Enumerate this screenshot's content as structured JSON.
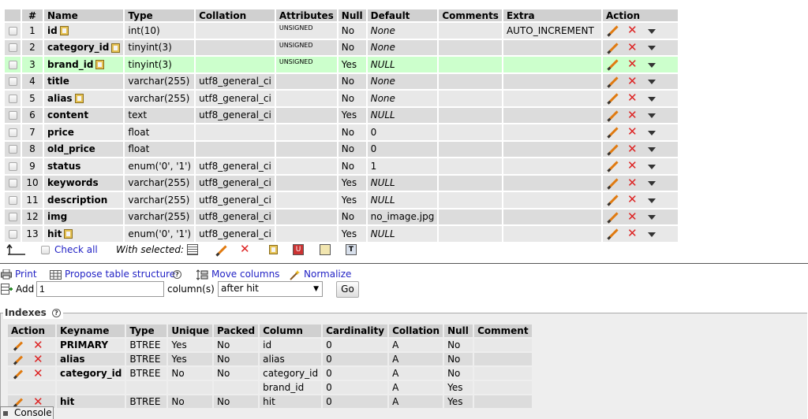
{
  "structure": {
    "columns": [
      "",
      "#",
      "Name",
      "Type",
      "Collation",
      "Attributes",
      "Null",
      "Default",
      "Comments",
      "Extra",
      "Action"
    ],
    "rows": [
      {
        "num": "1",
        "name": "id",
        "key": true,
        "type": "int(10)",
        "collation": "",
        "attributes": "UNSIGNED",
        "null": "No",
        "default": "None",
        "default_italic": true,
        "comments": "",
        "extra": "AUTO_INCREMENT"
      },
      {
        "num": "2",
        "name": "category_id",
        "key": true,
        "type": "tinyint(3)",
        "collation": "",
        "attributes": "UNSIGNED",
        "null": "No",
        "default": "None",
        "default_italic": true,
        "comments": "",
        "extra": ""
      },
      {
        "num": "3",
        "name": "brand_id",
        "key": true,
        "type": "tinyint(3)",
        "collation": "",
        "attributes": "UNSIGNED",
        "null": "Yes",
        "default": "NULL",
        "default_italic": true,
        "comments": "",
        "extra": "",
        "highlight": true
      },
      {
        "num": "4",
        "name": "title",
        "key": false,
        "type": "varchar(255)",
        "collation": "utf8_general_ci",
        "attributes": "",
        "null": "No",
        "default": "None",
        "default_italic": true,
        "comments": "",
        "extra": ""
      },
      {
        "num": "5",
        "name": "alias",
        "key": true,
        "type": "varchar(255)",
        "collation": "utf8_general_ci",
        "attributes": "",
        "null": "No",
        "default": "None",
        "default_italic": true,
        "comments": "",
        "extra": ""
      },
      {
        "num": "6",
        "name": "content",
        "key": false,
        "type": "text",
        "collation": "utf8_general_ci",
        "attributes": "",
        "null": "Yes",
        "default": "NULL",
        "default_italic": true,
        "comments": "",
        "extra": ""
      },
      {
        "num": "7",
        "name": "price",
        "key": false,
        "type": "float",
        "collation": "",
        "attributes": "",
        "null": "No",
        "default": "0",
        "default_italic": false,
        "comments": "",
        "extra": ""
      },
      {
        "num": "8",
        "name": "old_price",
        "key": false,
        "type": "float",
        "collation": "",
        "attributes": "",
        "null": "No",
        "default": "0",
        "default_italic": false,
        "comments": "",
        "extra": ""
      },
      {
        "num": "9",
        "name": "status",
        "key": false,
        "type": "enum('0', '1')",
        "collation": "utf8_general_ci",
        "attributes": "",
        "null": "No",
        "default": "1",
        "default_italic": false,
        "comments": "",
        "extra": ""
      },
      {
        "num": "10",
        "name": "keywords",
        "key": false,
        "type": "varchar(255)",
        "collation": "utf8_general_ci",
        "attributes": "",
        "null": "Yes",
        "default": "NULL",
        "default_italic": true,
        "comments": "",
        "extra": ""
      },
      {
        "num": "11",
        "name": "description",
        "key": false,
        "type": "varchar(255)",
        "collation": "utf8_general_ci",
        "attributes": "",
        "null": "Yes",
        "default": "NULL",
        "default_italic": true,
        "comments": "",
        "extra": ""
      },
      {
        "num": "12",
        "name": "img",
        "key": false,
        "type": "varchar(255)",
        "collation": "utf8_general_ci",
        "attributes": "",
        "null": "No",
        "default": "no_image.jpg",
        "default_italic": false,
        "comments": "",
        "extra": ""
      },
      {
        "num": "13",
        "name": "hit",
        "key": true,
        "type": "enum('0', '1')",
        "collation": "utf8_general_ci",
        "attributes": "",
        "null": "Yes",
        "default": "NULL",
        "default_italic": true,
        "comments": "",
        "extra": ""
      }
    ]
  },
  "bulk": {
    "check_all": "Check all",
    "with_selected": "With selected:"
  },
  "ops": {
    "print": "Print",
    "propose": "Propose table structure",
    "move_columns": "Move columns",
    "normalize": "Normalize",
    "add_label": "Add",
    "add_value": "1",
    "columns_label": "column(s)",
    "position_select": "after hit",
    "go": "Go"
  },
  "indexes": {
    "legend": "Indexes",
    "columns": [
      "Action",
      "Keyname",
      "Type",
      "Unique",
      "Packed",
      "Column",
      "Cardinality",
      "Collation",
      "Null",
      "Comment"
    ],
    "rows": [
      {
        "keyname": "PRIMARY",
        "type": "BTREE",
        "unique": "Yes",
        "packed": "No",
        "column": "id",
        "cardinality": "0",
        "collation": "A",
        "null": "No",
        "comment": ""
      },
      {
        "keyname": "alias",
        "type": "BTREE",
        "unique": "Yes",
        "packed": "No",
        "column": "alias",
        "cardinality": "0",
        "collation": "A",
        "null": "No",
        "comment": ""
      },
      {
        "keyname": "category_id",
        "type": "BTREE",
        "unique": "No",
        "packed": "No",
        "column": "category_id",
        "cardinality": "0",
        "collation": "A",
        "null": "No",
        "comment": "",
        "column2": "brand_id",
        "cardinality2": "0",
        "collation2": "A",
        "null2": "Yes"
      },
      {
        "keyname": "hit",
        "type": "BTREE",
        "unique": "No",
        "packed": "No",
        "column": "hit",
        "cardinality": "0",
        "collation": "A",
        "null": "Yes",
        "comment": ""
      }
    ]
  },
  "console": "Console",
  "colors": {
    "highlight": "#ccffcc",
    "link": "#2323c5",
    "delete": "#dd2222",
    "edit": "#e07a10"
  }
}
